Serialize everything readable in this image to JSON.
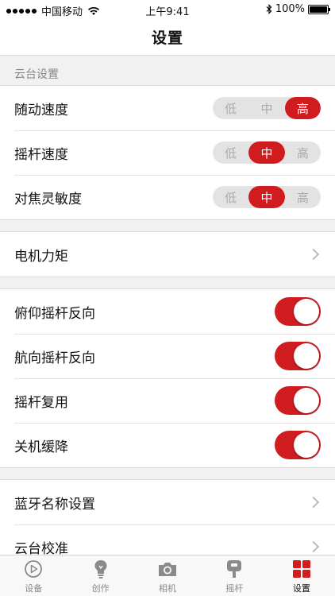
{
  "status_bar": {
    "carrier": "中国移动",
    "time": "上午9:41",
    "battery": "100%"
  },
  "nav": {
    "title": "设置"
  },
  "gimbal_section": {
    "header": "云台设置",
    "rows": [
      {
        "label": "随动速度",
        "options": [
          "低",
          "中",
          "高"
        ],
        "selected": "高"
      },
      {
        "label": "摇杆速度",
        "options": [
          "低",
          "中",
          "高"
        ],
        "selected": "中"
      },
      {
        "label": "对焦灵敏度",
        "options": [
          "低",
          "中",
          "高"
        ],
        "selected": "中"
      }
    ]
  },
  "motor": {
    "label": "电机力矩"
  },
  "toggles": [
    {
      "label": "俯仰摇杆反向",
      "on": true
    },
    {
      "label": "航向摇杆反向",
      "on": true
    },
    {
      "label": "摇杆复用",
      "on": true
    },
    {
      "label": "关机缓降",
      "on": true
    }
  ],
  "more": [
    {
      "label": "蓝牙名称设置"
    },
    {
      "label": "云台校准"
    }
  ],
  "tabs": [
    {
      "label": "设备",
      "icon": "play-circle-icon"
    },
    {
      "label": "创作",
      "icon": "lightbulb-icon"
    },
    {
      "label": "相机",
      "icon": "camera-icon"
    },
    {
      "label": "摇杆",
      "icon": "joystick-icon"
    },
    {
      "label": "设置",
      "icon": "grid-icon",
      "active": true
    }
  ],
  "colors": {
    "accent": "#d01c1f",
    "segment_bg": "#e3e3e3",
    "page_bg": "#f1f1f1"
  }
}
